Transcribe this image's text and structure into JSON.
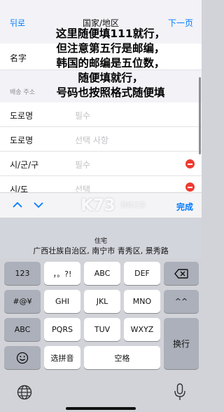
{
  "nav": {
    "back": "뒤로",
    "title": "国家/地区",
    "next": "下一页"
  },
  "rows": [
    {
      "label": "名字",
      "value": ""
    },
    {
      "label": "도로명",
      "value": "필수"
    },
    {
      "label": "도로명",
      "value": "선택 사항"
    },
    {
      "label": "시/군/구",
      "value": "필수"
    },
    {
      "label": "시/도",
      "value": "선택"
    }
  ],
  "section_header": "배송 주소",
  "note": {
    "lines": [
      "这里随便填111就行，",
      "但注意第五行是邮编，",
      "韩国的邮编是五位数，",
      "随便填就行，",
      "号码也按照格式随便填"
    ]
  },
  "toolbar": {
    "up": "∧",
    "down": "∨",
    "done": "完成"
  },
  "watermark": {
    "main": "K73",
    "sub": "游戏之家"
  },
  "suggestion": {
    "top": "住宅",
    "main": "广西壮族自治区, 南宁市 青秀区, 景秀路"
  },
  "keyboard": {
    "rows": [
      [
        "123",
        "，。?!",
        "ABC",
        "DEF",
        "⌫"
      ],
      [
        "#@¥",
        "GHI",
        "JKL",
        "MNO",
        "^^"
      ],
      [
        "ABC",
        "PQRS",
        "TUV",
        "WXYZ",
        "换行"
      ],
      [
        "☺",
        "选拼音",
        "空格"
      ]
    ]
  }
}
